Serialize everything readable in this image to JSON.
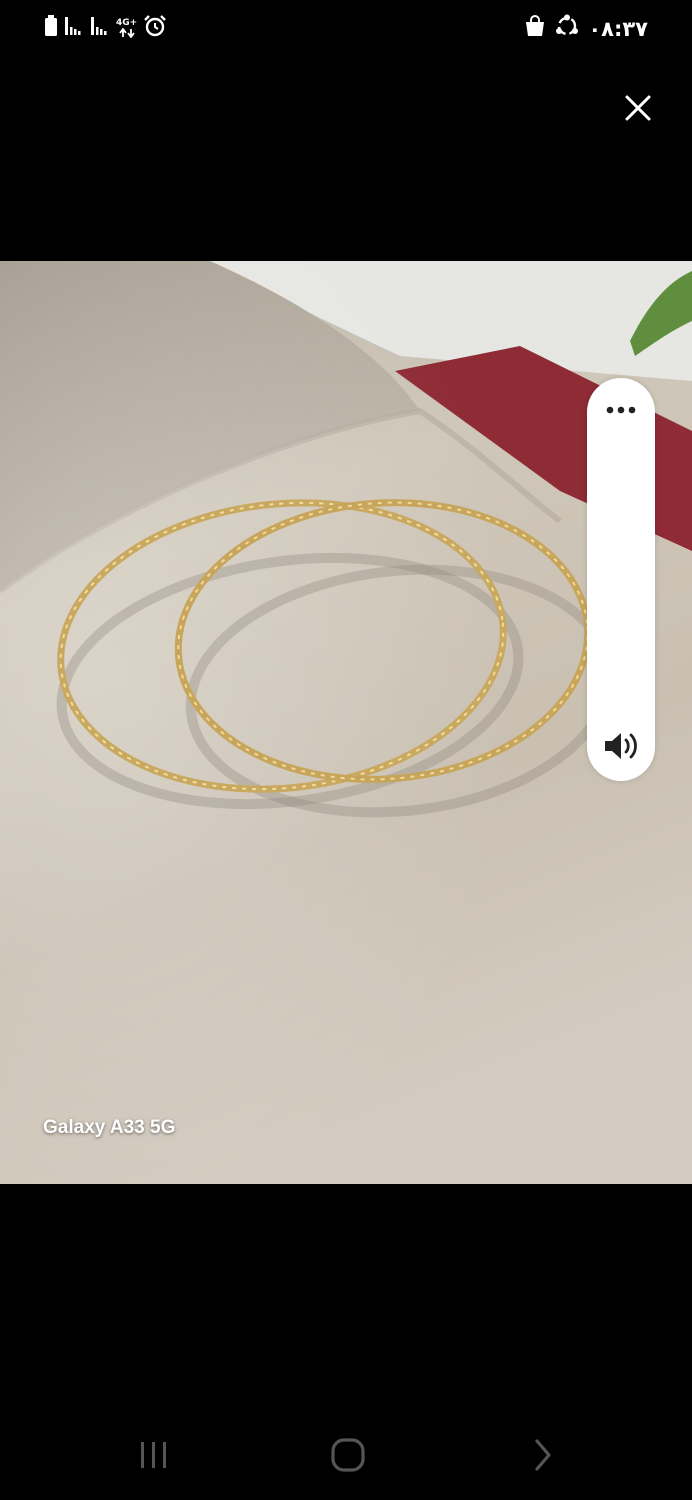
{
  "status_bar": {
    "time": "۰۸:۳۷",
    "network_type": "4G+",
    "icons": [
      "battery-icon",
      "signal-sim1-icon",
      "signal-sim2-icon",
      "network-4g-icon",
      "alarm-icon",
      "shopping-bag-icon",
      "sync-icon"
    ]
  },
  "viewer": {
    "close_icon": "close-icon",
    "watermark": "Galaxy A33 5G",
    "side_panel": {
      "more_icon": "more-options-icon",
      "volume_icon": "volume-icon"
    }
  },
  "navigation": {
    "icons": [
      "recent-apps-icon",
      "home-icon",
      "back-icon"
    ]
  },
  "colors": {
    "background": "#000000",
    "panel": "#ffffff",
    "gold": "#c9a85f",
    "fabric": "#cfc6b8"
  }
}
